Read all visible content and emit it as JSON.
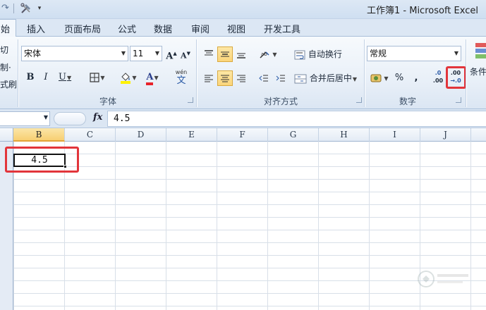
{
  "window": {
    "title": "工作簿1 - Microsoft Excel"
  },
  "tabs": [
    {
      "label": "始",
      "active": true
    },
    {
      "label": "插入"
    },
    {
      "label": "页面布局"
    },
    {
      "label": "公式"
    },
    {
      "label": "数据"
    },
    {
      "label": "审阅"
    },
    {
      "label": "视图"
    },
    {
      "label": "开发工具"
    }
  ],
  "clipboard": {
    "line1": "切",
    "line2": "制·",
    "line3": "式刷"
  },
  "font_group": {
    "label": "字体",
    "font_name": "宋体",
    "font_size": "11",
    "grow_label": "A",
    "shrink_label": "A",
    "bold": "B",
    "italic": "I",
    "underline": "U",
    "font_color_letter": "A",
    "phonetic_label": "wén",
    "phonetic_char": "文"
  },
  "alignment_group": {
    "label": "对齐方式",
    "wrap_text": "自动换行",
    "merge_center": "合并后居中"
  },
  "number_group": {
    "label": "数字",
    "format": "常规",
    "percent": "%",
    "comma": ",",
    "increase_decimal_top": ".0",
    "increase_decimal_bottom": ".00",
    "decrease_decimal_top": ".00",
    "decrease_decimal_bottom": "→.0"
  },
  "styles_group": {
    "partial_label": "条件"
  },
  "formula_bar": {
    "fx": "fx",
    "value": "4.5"
  },
  "columns": [
    "B",
    "C",
    "D",
    "E",
    "F",
    "G",
    "H",
    "I",
    "J"
  ],
  "active_cell": {
    "value": "4.5"
  },
  "colors": {
    "highlight": "#e2353b",
    "selected_column": "#f7cf72",
    "font_color_bar": "#e8232a",
    "fill_color_bar": "#fff200"
  }
}
